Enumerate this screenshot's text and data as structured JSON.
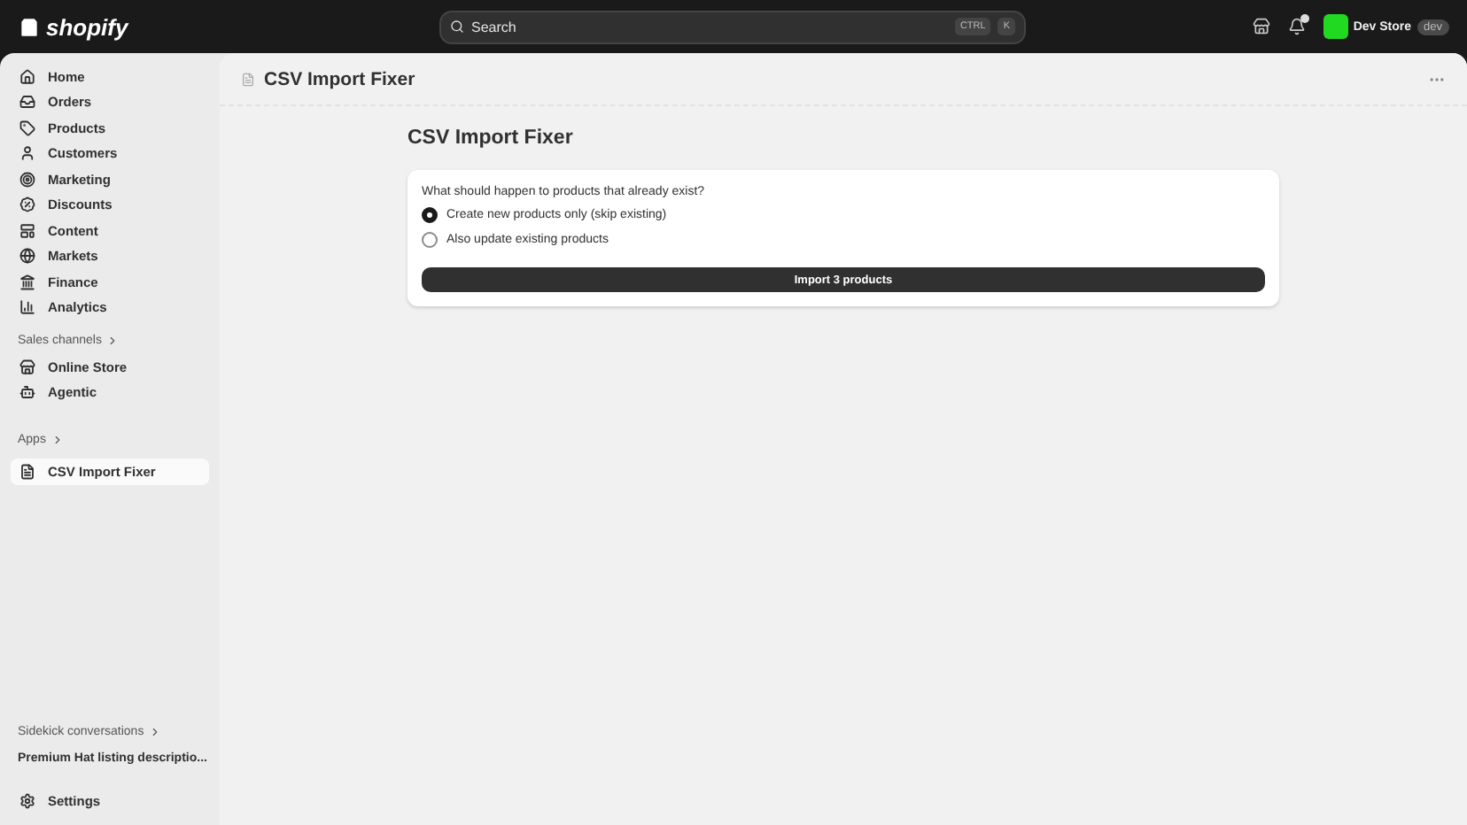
{
  "topbar": {
    "logo": "shopify",
    "search": {
      "placeholder": "Search",
      "keys": [
        "CTRL",
        "K"
      ]
    },
    "store": {
      "name": "Dev Store",
      "badge": "dev",
      "color": "#22d922"
    }
  },
  "sidebar": {
    "items": [
      {
        "label": "Home",
        "selected": false
      },
      {
        "label": "Orders",
        "selected": false
      },
      {
        "label": "Products",
        "selected": false
      },
      {
        "label": "Customers",
        "selected": false
      },
      {
        "label": "Marketing",
        "selected": false
      },
      {
        "label": "Discounts",
        "selected": false
      },
      {
        "label": "Content",
        "selected": false
      },
      {
        "label": "Markets",
        "selected": false
      },
      {
        "label": "Finance",
        "selected": false
      },
      {
        "label": "Analytics",
        "selected": false
      }
    ],
    "sales_channels": {
      "heading": "Sales channels",
      "items": [
        {
          "label": "Online Store",
          "selected": false
        },
        {
          "label": "Agentic",
          "selected": false
        }
      ]
    },
    "apps": {
      "heading": "Apps",
      "items": [
        {
          "label": "CSV Import Fixer",
          "selected": true
        }
      ]
    },
    "sidekick": {
      "heading": "Sidekick conversations",
      "items": [
        "Premium Hat listing descriptio..."
      ]
    },
    "settings": "Settings"
  },
  "page": {
    "header_title": "CSV Import Fixer",
    "title": "CSV Import Fixer",
    "card": {
      "question": "What should happen to products that already exist?",
      "options": [
        {
          "label": "Create new products only (skip existing)",
          "selected": true
        },
        {
          "label": "Also update existing products",
          "selected": false
        }
      ],
      "button": "Import 3 products"
    }
  }
}
